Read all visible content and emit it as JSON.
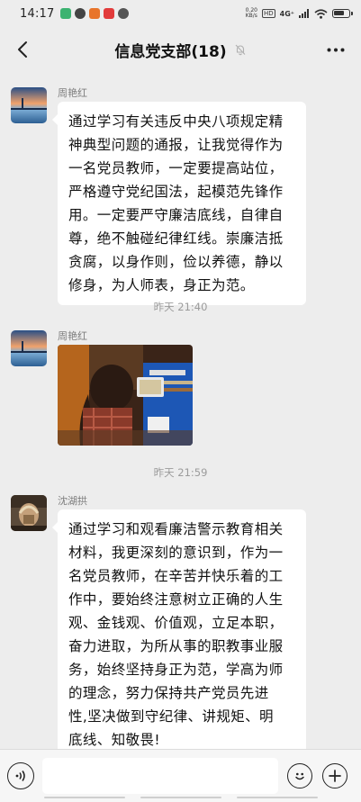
{
  "status_bar": {
    "time": "14:17",
    "net_speed_value": "0.20",
    "net_speed_unit": "KB/s",
    "hd": "HD",
    "signal": "4G⁺"
  },
  "header": {
    "title": "信息党支部(18)"
  },
  "messages": [
    {
      "sender": "周艳红",
      "text": "通过学习有关违反中央八项规定精\n神典型问题的通报，让我觉得作为\n一名党员教师，一定要提高站位，\n严格遵守党纪国法，起模范先锋作\n用。一定要严守廉洁底线，自律自\n尊，绝不触碰纪律红线。崇廉洁抵\n贪腐，以身作则，俭以养德，静以\n修身，为人师表，身正为范。"
    },
    {
      "timestamp": "昨天 21:40"
    },
    {
      "sender": "周艳红",
      "image": "photo"
    },
    {
      "timestamp": "昨天 21:59"
    },
    {
      "sender": "沈湖拱",
      "text": "通过学习和观看廉洁警示教育相关\n材料，我更深刻的意识到，作为一\n名党员教师，在辛苦并快乐着的工\n作中，要始终注意树立正确的人生\n观、金钱观、价值观，立足本职，\n奋力进取，为所从事的职教事业服\n务，始终坚持身正为范，学高为师\n的理念，努力保持共产党员先进\n性,坚决做到守纪律、讲规矩、明\n底线、知敬畏!"
    }
  ],
  "input": {
    "value": ""
  },
  "icons": {
    "back": "back-arrow-icon",
    "mute": "mute-bell-icon",
    "more": "more-dots-icon",
    "voice": "voice-icon",
    "emoji": "emoji-icon",
    "plus": "plus-icon"
  },
  "colors": {
    "background": "#ededed",
    "bubble": "#ffffff",
    "sender": "#7d7d7d",
    "timestamp": "#9b9b9b"
  }
}
